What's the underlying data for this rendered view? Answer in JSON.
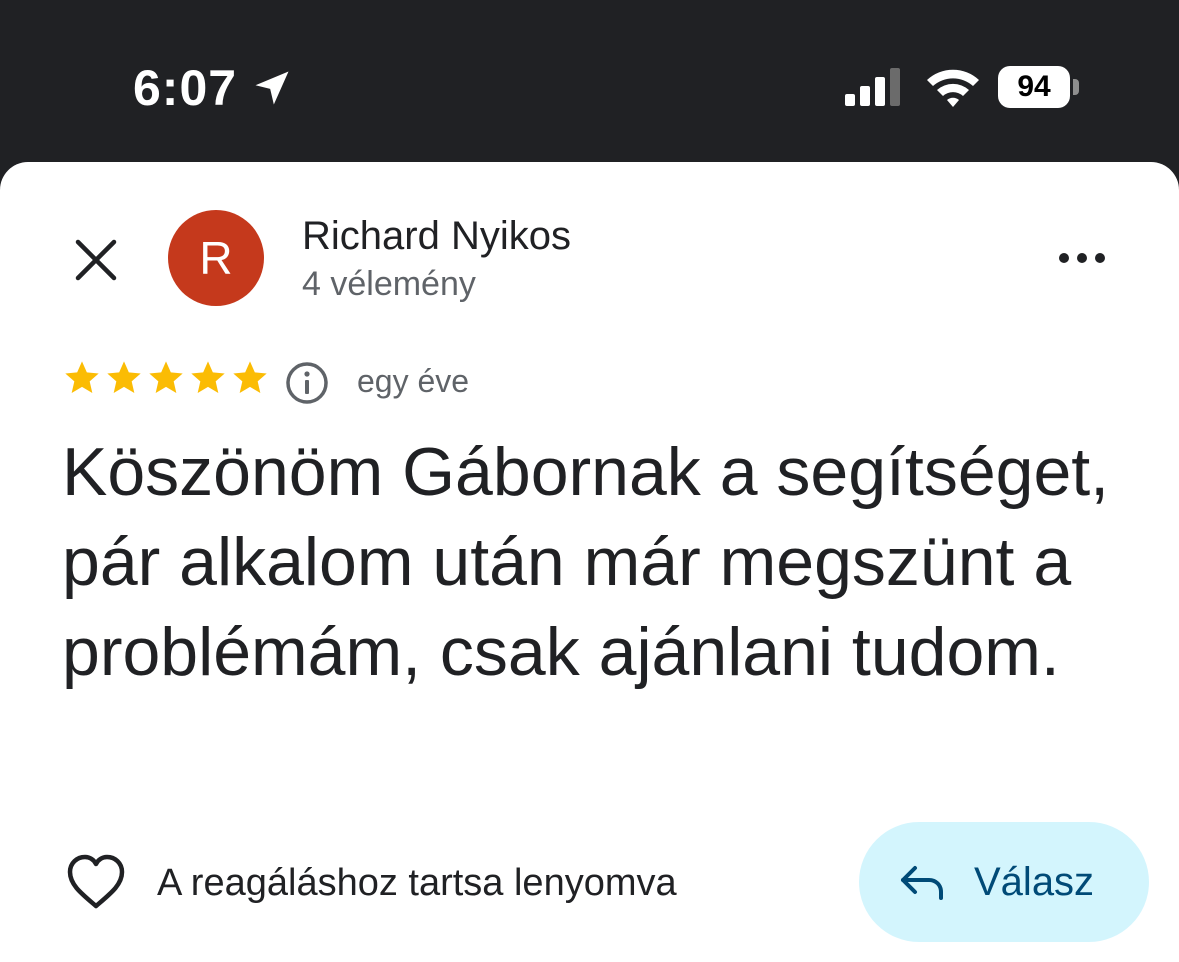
{
  "status_bar": {
    "time": "6:07",
    "battery": "94",
    "icons": [
      "location-arrow-icon",
      "cellular-signal-icon",
      "wifi-icon",
      "battery-icon"
    ]
  },
  "review": {
    "reviewer_name": "Richard Nyikos",
    "avatar_initial": "R",
    "review_count": "4 vélemény",
    "rating": 5,
    "rating_max": 5,
    "date": "egy éve",
    "text": "Köszönöm Gábornak a segítséget, pár alkalom után már megszünt a problémám, csak ajánlani tudom."
  },
  "actions": {
    "react_hint": "A reagáláshoz tartsa lenyomva",
    "reply_label": "Válasz"
  },
  "colors": {
    "status_bar_bg": "#202124",
    "avatar_bg": "#c5391c",
    "star": "#fbbc04",
    "reply_bg": "#d3f5fd",
    "reply_text": "#004a77"
  }
}
